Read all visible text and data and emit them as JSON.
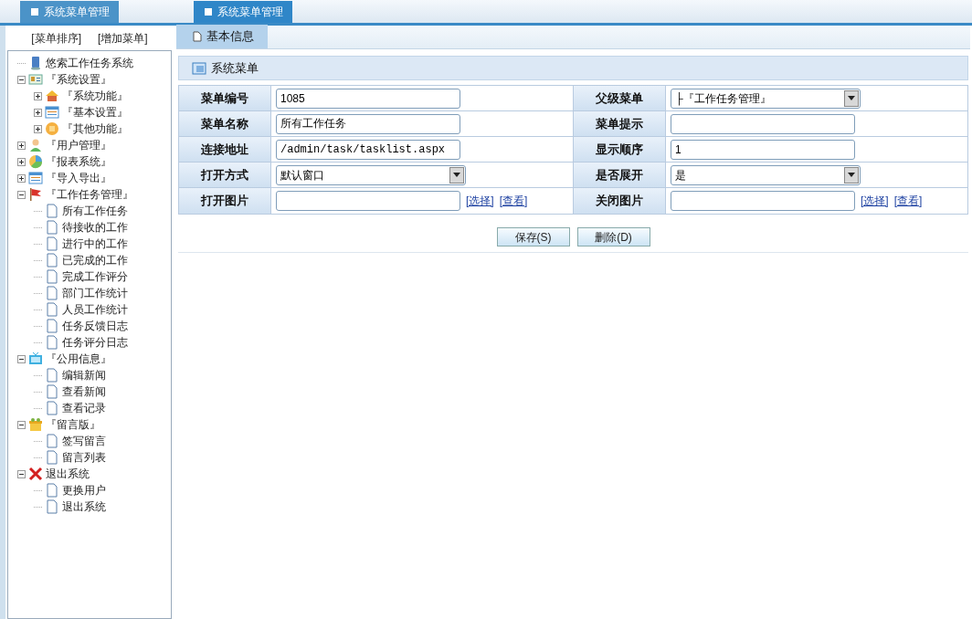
{
  "top_tabs": [
    {
      "label": "系统菜单管理",
      "selected": false
    },
    {
      "label": "系统菜单管理",
      "selected": true
    }
  ],
  "sidebar": {
    "actions": [
      "[菜单排序]",
      "[增加菜单]"
    ],
    "tree": [
      {
        "label": "悠索工作任务系统",
        "kind": "system"
      },
      {
        "label": "『系统设置』",
        "kind": "settings",
        "expanded": true,
        "children": [
          {
            "label": "『系统功能』",
            "kind": "function",
            "expanded": false
          },
          {
            "label": "『基本设置』",
            "kind": "form",
            "expanded": false
          },
          {
            "label": "『其他功能』",
            "kind": "coin",
            "expanded": false
          }
        ]
      },
      {
        "label": "『用户管理』",
        "kind": "user",
        "expanded": false
      },
      {
        "label": "『报表系统』",
        "kind": "pie",
        "expanded": false
      },
      {
        "label": "『导入导出』",
        "kind": "form",
        "expanded": false
      },
      {
        "label": "『工作任务管理』",
        "kind": "flag",
        "expanded": true,
        "children": [
          {
            "label": "所有工作任务",
            "kind": "page"
          },
          {
            "label": "待接收的工作",
            "kind": "page"
          },
          {
            "label": "进行中的工作",
            "kind": "page"
          },
          {
            "label": "已完成的工作",
            "kind": "page"
          },
          {
            "label": "完成工作评分",
            "kind": "page"
          },
          {
            "label": "部门工作统计",
            "kind": "page"
          },
          {
            "label": "人员工作统计",
            "kind": "page"
          },
          {
            "label": "任务反馈日志",
            "kind": "page"
          },
          {
            "label": "任务评分日志",
            "kind": "page"
          }
        ]
      },
      {
        "label": "『公用信息』",
        "kind": "tv",
        "expanded": true,
        "children": [
          {
            "label": "编辑新闻",
            "kind": "page"
          },
          {
            "label": "查看新闻",
            "kind": "page"
          },
          {
            "label": "查看记录",
            "kind": "page"
          }
        ]
      },
      {
        "label": "『留言版』",
        "kind": "gift",
        "expanded": true,
        "children": [
          {
            "label": "签写留言",
            "kind": "page"
          },
          {
            "label": "留言列表",
            "kind": "page"
          }
        ]
      },
      {
        "label": "退出系统",
        "kind": "exit",
        "expanded": true,
        "children": [
          {
            "label": "更换用户",
            "kind": "page"
          },
          {
            "label": "退出系统",
            "kind": "page"
          }
        ]
      }
    ]
  },
  "content_tabs": [
    {
      "label": "基本信息",
      "selected": true
    }
  ],
  "section_title": "系统菜单",
  "form": {
    "rows": [
      [
        {
          "label": "菜单编号",
          "kind": "text",
          "value": "1085"
        },
        {
          "label": "父级菜单",
          "kind": "select",
          "value": "├『工作任务管理』"
        }
      ],
      [
        {
          "label": "菜单名称",
          "kind": "text",
          "value": "所有工作任务"
        },
        {
          "label": "菜单提示",
          "kind": "text"
        }
      ],
      [
        {
          "label": "连接地址",
          "kind": "text",
          "value": "/admin/task/tasklist.aspx",
          "mono": true
        },
        {
          "label": "显示顺序",
          "kind": "text",
          "value": "1"
        }
      ],
      [
        {
          "label": "打开方式",
          "kind": "select",
          "value": "默认窗口"
        },
        {
          "label": "是否展开",
          "kind": "select",
          "value": "是"
        }
      ],
      [
        {
          "label": "打开图片",
          "kind": "image",
          "links": [
            "[选择]",
            "[查看]"
          ]
        },
        {
          "label": "关闭图片",
          "kind": "image",
          "links": [
            "[选择]",
            "[查看]"
          ]
        }
      ]
    ]
  },
  "buttons": [
    "保存(S)",
    "删除(D)"
  ]
}
